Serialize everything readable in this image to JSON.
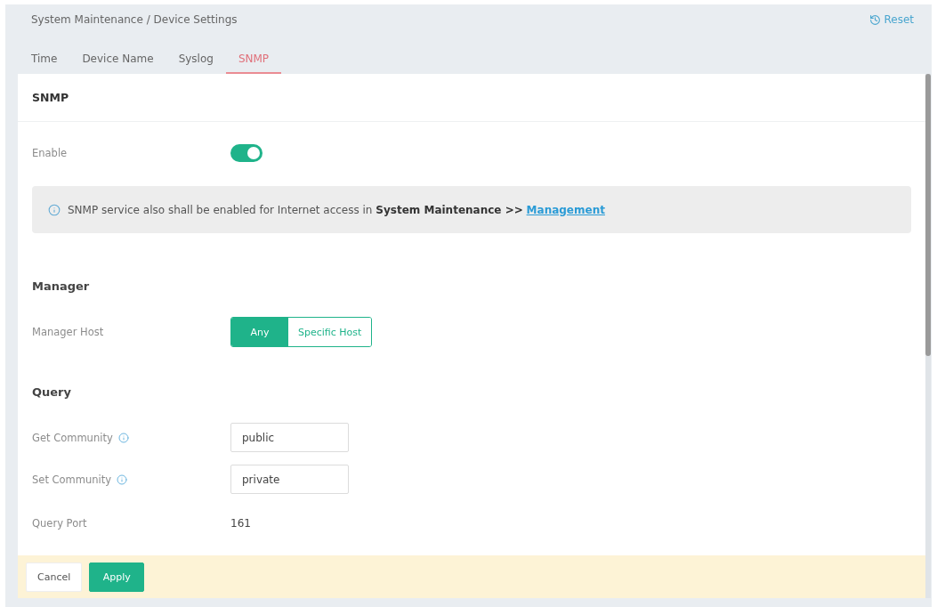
{
  "breadcrumb": "System Maintenance / Device Settings",
  "reset_button": {
    "label": "Reset"
  },
  "tabs": [
    {
      "label": "Time",
      "selected": false
    },
    {
      "label": "Device Name",
      "selected": false
    },
    {
      "label": "Syslog",
      "selected": false
    },
    {
      "label": "SNMP",
      "selected": true
    }
  ],
  "panel": {
    "title": "SNMP",
    "enable": {
      "label": "Enable",
      "on": true
    },
    "notice": {
      "text": "SNMP service also shall be enabled for Internet access in **System Maintenance >>**",
      "link": "Management"
    },
    "sections": [
      {
        "title": "Manager",
        "fields": [
          {
            "kind": "segmented",
            "label": "Manager Host",
            "help": false,
            "options": [
              {
                "label": "Any",
                "selected": true
              },
              {
                "label": "Specific Host",
                "selected": false
              }
            ]
          }
        ]
      },
      {
        "title": "Query",
        "fields": [
          {
            "kind": "input",
            "label": "Get Community",
            "help": true,
            "value": "public"
          },
          {
            "kind": "input",
            "label": "Set Community",
            "help": true,
            "value": "private"
          },
          {
            "kind": "text",
            "label": "Query Port",
            "help": false,
            "value": "161"
          }
        ]
      }
    ]
  },
  "footer": {
    "buttons": [
      {
        "kind": "cancel",
        "label": "Cancel"
      },
      {
        "kind": "apply",
        "label": "Apply"
      }
    ]
  }
}
